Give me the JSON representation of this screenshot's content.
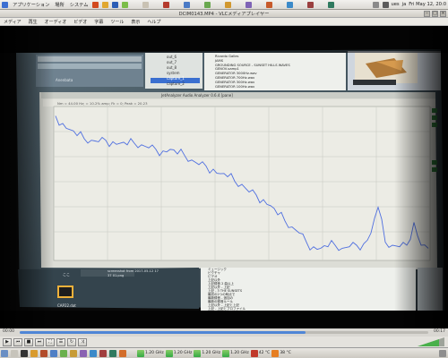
{
  "top_panel": {
    "menus": [
      "アプリケーション",
      "場所",
      "システム"
    ],
    "clock": "Fri May 12, 20:0",
    "user": "ues",
    "lang": "ja"
  },
  "window": {
    "title": "DCIM0143.MP4 - VLCメディアプレイヤー"
  },
  "vlc_menu": [
    "メディア",
    "再生",
    "オーディオ",
    "ビデオ",
    "字幕",
    "ツール",
    "表示",
    "ヘルプ"
  ],
  "video": {
    "analyzer_title": "JetAnalyzer Audio Analyzer 0.6.4 [pane]",
    "readout": "Nm = 44.00 Hz; = 10.2% amp; Fk = 0; Peak = 20.23",
    "file_tree": [
      "out_6",
      "out_7",
      "out_8",
      "system",
      "capture_1",
      "capture_2"
    ],
    "browser_items": [
      "Ricardo Galles",
      "JAMS",
      "GROUNDING SOURCE - SUNSET HILLS WAVES",
      "GENOV-samp1",
      "GENERATOR 3000Hz.wav",
      "GENERATOR 700Hz.wav",
      "GENERATOR 300Hz.wav",
      "GENERATOR 100Hz.wav"
    ],
    "lower_list": [
      "ミュージック",
      "ピクチャ",
      "ビデオ",
      "上記以外",
      "上記録音 2 曲以上",
      "上記以外 - 上記",
      "上記 - 3 THE SUNSETS",
      "最初の2つの時点で",
      "最新録音 - 追加の",
      "最新の録音ルール",
      "上記以外 - 上記と上記",
      "上記 - 上記とプロファイル"
    ],
    "desktop_file": "CAP22.dat",
    "desktop_label_2": "screenshot from 2017-05-12 17 37 01.png",
    "desktop_label_1": "Anenbata",
    "desktop_label_3": "ここ"
  },
  "chart_data": {
    "type": "line",
    "title": "",
    "xlabel": "",
    "ylabel": "",
    "series": [
      {
        "values": [
          0.95,
          0.9,
          0.86,
          0.82,
          0.8,
          0.79,
          0.78,
          0.79,
          0.78,
          0.77,
          0.76,
          0.77,
          0.76,
          0.74,
          0.73,
          0.72,
          0.73,
          0.7,
          0.69,
          0.66,
          0.63,
          0.62,
          0.6,
          0.57,
          0.55,
          0.52,
          0.5,
          0.45,
          0.43,
          0.4,
          0.36,
          0.3,
          0.26,
          0.22,
          0.18,
          0.12,
          0.09,
          0.08,
          0.09,
          0.1,
          0.08,
          0.09,
          0.1,
          0.11,
          0.18,
          0.35,
          0.12,
          0.1,
          0.09,
          0.1,
          0.25,
          0.1,
          0.08
        ]
      }
    ]
  },
  "playback": {
    "time_elapsed": "00:00",
    "time_total": "00:17",
    "progress": 0.7
  },
  "taskbar": {
    "freq_labels": [
      "1.20 GHz",
      "1.20 GHz",
      "1.20 GHz",
      "1.20 GHz"
    ],
    "temp": "42 °C",
    "temp2": "38 °C"
  },
  "colors": {
    "plot_line": "#4f6fe0",
    "plot_bg": "#ecece5",
    "accent": "#4f86d6"
  }
}
